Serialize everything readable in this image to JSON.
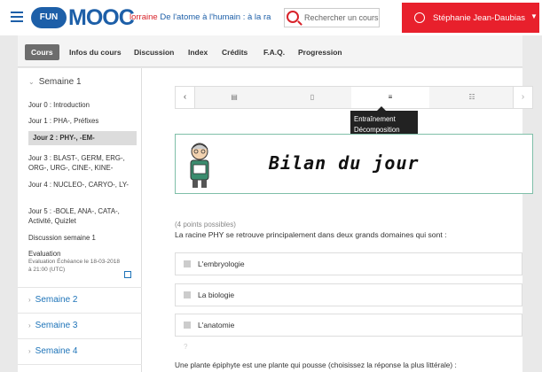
{
  "header": {
    "logo_fun": "FUN",
    "logo_mooc": "MOOC",
    "org": "lorraine",
    "course_name": "De l'atome à l'humain : à la ra",
    "search_placeholder": "Rechercher un cours",
    "user_name": "Stéphanie Jean-Daubias",
    "accent": "#e8202c",
    "brand": "#1d5fa8"
  },
  "tabs": [
    "Cours",
    "Infos du cours",
    "Discussion",
    "Index",
    "Crédits",
    "F.A.Q.",
    "Progression"
  ],
  "sidebar": {
    "chapter_open": "Semaine 1",
    "items": [
      "Jour 0 : Introduction",
      "Jour 1 : PHA-, Préfixes",
      "Jour 2 : PHY-, -EM-",
      "Jour 3 : BLAST-, GERM, ERG-, ORG-, URG-, CINE-, KINE-",
      "Jour 4 : NUCLEO-, CARYO-, LY-",
      "Jour 5 : -BOLE, ANA-, CATA-, Activité, Quizlet",
      "Discussion semaine 1",
      "Evaluation"
    ],
    "evaluation_sub": "Evaluation Échéance le 18-03-2018 à 21:00 (UTC)",
    "chapters_closed": [
      "Semaine 2",
      "Semaine 3",
      "Semaine 4"
    ]
  },
  "seqnav": {
    "prev": "‹",
    "next": "›",
    "tabs": [
      "▤",
      "▯",
      "≡",
      "☷"
    ],
    "tooltip_line1": "Entraînement",
    "tooltip_line2": "Décomposition"
  },
  "banner": {
    "title": "Bilan du jour"
  },
  "problem": {
    "points": "(4 points possibles)",
    "question": "La racine PHY se retrouve principalement dans deux grands domaines qui sont :",
    "choices": [
      "L'embryologie",
      "La biologie",
      "L'anatomie"
    ],
    "hint": "?",
    "question2": "Une plante épiphyte est une plante qui pousse (choisissez la réponse la plus littérale) :"
  }
}
